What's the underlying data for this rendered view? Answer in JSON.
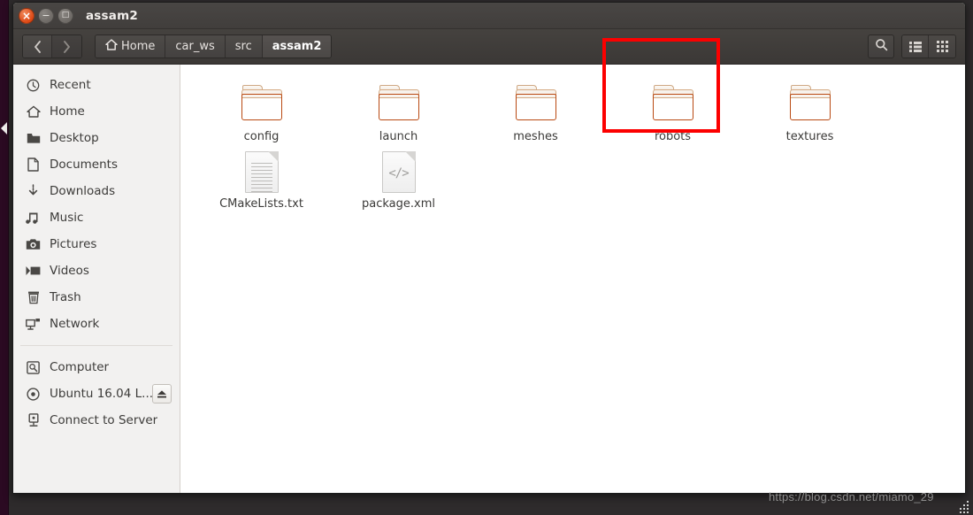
{
  "window": {
    "title": "assam2",
    "buttons": {
      "close": "×",
      "minimize": "−",
      "maximize": "□"
    }
  },
  "toolbar": {
    "back_label": "Back",
    "forward_label": "Forward",
    "breadcrumbs": [
      {
        "label": "Home",
        "icon": "home-icon",
        "active": false
      },
      {
        "label": "car_ws",
        "icon": "",
        "active": false
      },
      {
        "label": "src",
        "icon": "",
        "active": false
      },
      {
        "label": "assam2",
        "icon": "",
        "active": true
      }
    ],
    "search_label": "Search",
    "list_view_label": "List view",
    "grid_view_label": "Icon view"
  },
  "sidebar": {
    "groups": [
      {
        "items": [
          {
            "label": "Recent",
            "icon": "clock-icon"
          },
          {
            "label": "Home",
            "icon": "home-icon"
          },
          {
            "label": "Desktop",
            "icon": "folder-icon"
          },
          {
            "label": "Documents",
            "icon": "document-icon"
          },
          {
            "label": "Downloads",
            "icon": "download-icon"
          },
          {
            "label": "Music",
            "icon": "music-icon"
          },
          {
            "label": "Pictures",
            "icon": "camera-icon"
          },
          {
            "label": "Videos",
            "icon": "video-icon"
          },
          {
            "label": "Trash",
            "icon": "trash-icon"
          },
          {
            "label": "Network",
            "icon": "network-icon"
          }
        ]
      },
      {
        "items": [
          {
            "label": "Computer",
            "icon": "computer-icon"
          },
          {
            "label": "Ubuntu 16.04 L...",
            "icon": "disc-icon",
            "eject": true
          },
          {
            "label": "Connect to Server",
            "icon": "server-icon"
          }
        ]
      }
    ]
  },
  "main": {
    "items": [
      {
        "label": "config",
        "type": "folder"
      },
      {
        "label": "launch",
        "type": "folder"
      },
      {
        "label": "meshes",
        "type": "folder"
      },
      {
        "label": "robots",
        "type": "folder",
        "highlighted": true
      },
      {
        "label": "textures",
        "type": "folder"
      },
      {
        "label": "CMakeLists.txt",
        "type": "text-file"
      },
      {
        "label": "package.xml",
        "type": "code-file"
      }
    ]
  },
  "annotation": {
    "highlight_color": "#fc0000",
    "highlight_target": "robots"
  },
  "watermark": {
    "text": "https://blog.csdn.net/miamo_29"
  }
}
